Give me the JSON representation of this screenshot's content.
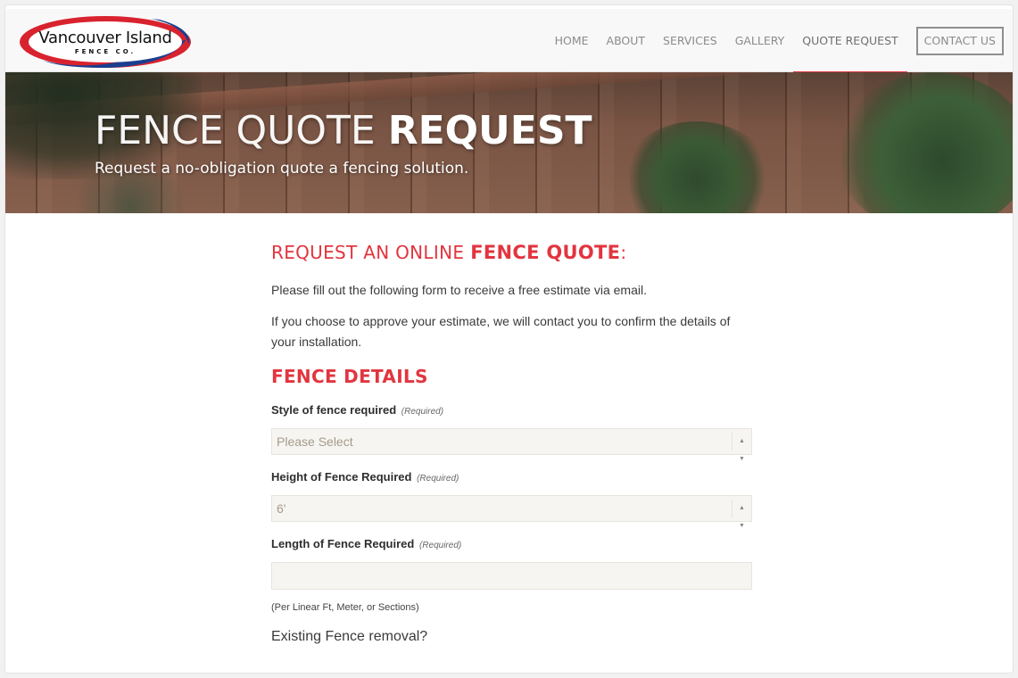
{
  "logo": {
    "main": "Vancouver Island",
    "sub": "FENCE CO."
  },
  "nav": {
    "items": [
      {
        "label": "HOME"
      },
      {
        "label": "ABOUT"
      },
      {
        "label": "SERVICES"
      },
      {
        "label": "GALLERY"
      },
      {
        "label": "QUOTE REQUEST"
      }
    ],
    "contact": "CONTACT US"
  },
  "colors": {
    "accent": "#e2353f",
    "field_bg": "#f6f5f1"
  },
  "hero": {
    "title_light": "FENCE QUOTE",
    "title_bold": "REQUEST",
    "subtitle": "Request a no-obligation quote a fencing solution."
  },
  "content": {
    "title_light": "REQUEST AN ONLINE",
    "title_bold": "FENCE QUOTE",
    "title_colon": ":",
    "intro1": "Please fill out the following form to receive a free estimate via email.",
    "intro2": "If you choose to approve your estimate, we will contact you to confirm the details of your installation.",
    "subhead": "FENCE DETAILS",
    "required_label": "(Required)",
    "fields": {
      "style": {
        "label": "Style of fence required",
        "value": "Please Select"
      },
      "height": {
        "label": "Height of Fence Required",
        "value": "6'"
      },
      "length": {
        "label": "Length of Fence Required",
        "value": "",
        "hint": "(Per Linear Ft, Meter, or Sections)"
      }
    },
    "existing": "Existing Fence removal?"
  }
}
